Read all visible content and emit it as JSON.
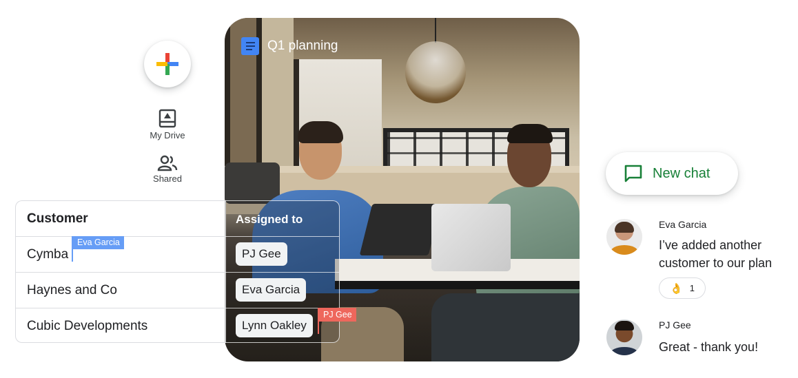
{
  "sidebar": {
    "fab_icon": "google-plus-icon",
    "colors": {
      "red": "#ea4335",
      "blue": "#4285f4",
      "green": "#34a853",
      "yellow": "#fbbc04"
    },
    "items": [
      {
        "label": "My Drive",
        "icon": "drive-icon"
      },
      {
        "label": "Shared",
        "icon": "people-icon"
      }
    ]
  },
  "document": {
    "title": "Q1 planning",
    "icon": "google-docs-icon",
    "icon_color": "#4285f4"
  },
  "table": {
    "headers": {
      "customer": "Customer",
      "assigned": "Assigned to"
    },
    "rows": [
      {
        "customer": "Cymba",
        "assigned": "PJ Gee"
      },
      {
        "customer": "Haynes and Co",
        "assigned": "Eva Garcia"
      },
      {
        "customer": "Cubic Developments",
        "assigned": "Lynn Oakley"
      }
    ],
    "collaborator_cursors": [
      {
        "name": "Eva Garcia",
        "color": "#669df6"
      },
      {
        "name": "PJ Gee",
        "color": "#ee675c"
      }
    ]
  },
  "chat": {
    "new_chat_label": "New chat",
    "new_chat_icon": "chat-bubble-icon",
    "accent": "#188038",
    "messages": [
      {
        "sender": "Eva Garcia",
        "line1": "I’ve added another",
        "line2": "customer to our plan",
        "reaction": {
          "emoji": "👌",
          "count": "1"
        }
      },
      {
        "sender": "PJ Gee",
        "line1": "Great - thank you!"
      }
    ]
  }
}
